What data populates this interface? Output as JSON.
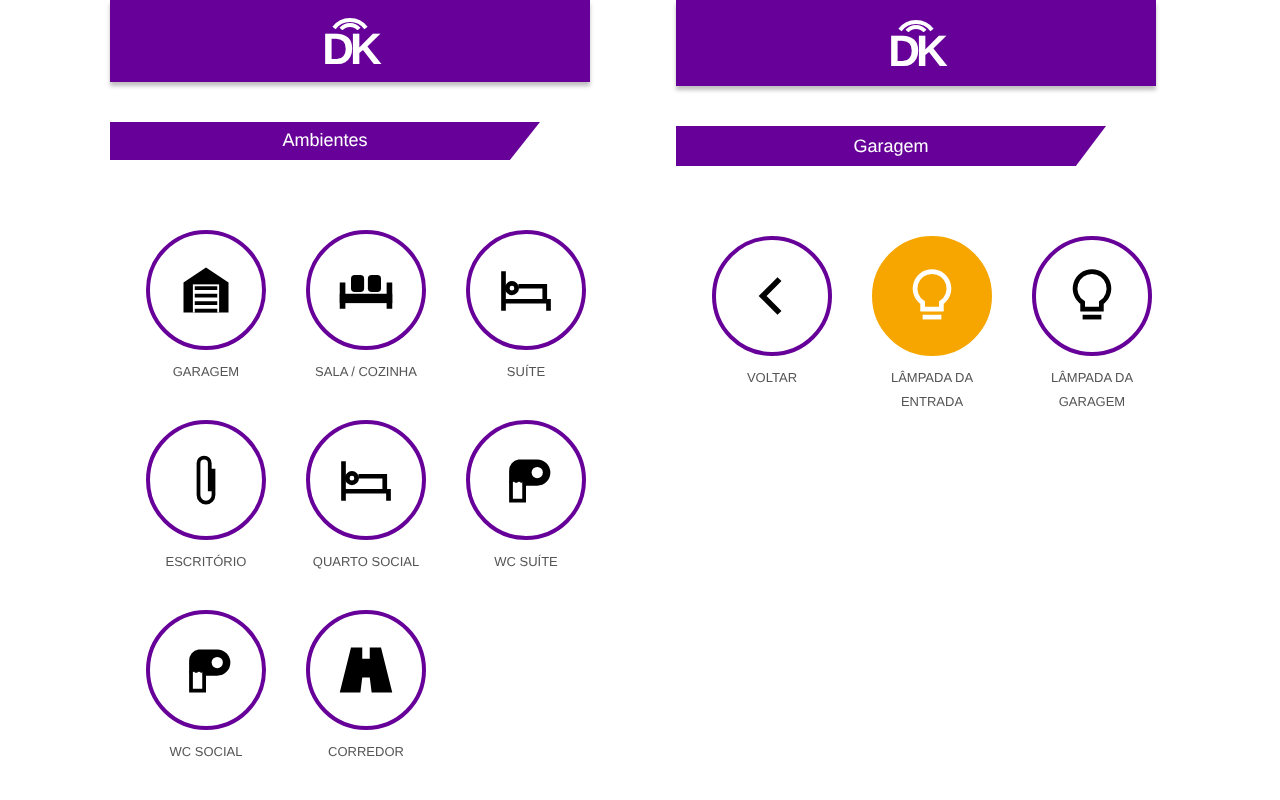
{
  "screens": [
    {
      "logo": "DK",
      "title": "Ambientes",
      "items": [
        {
          "kind": "garage",
          "label": "GARAGEM",
          "on": false
        },
        {
          "kind": "sofa",
          "label": "SALA / COZINHA",
          "on": false
        },
        {
          "kind": "bed",
          "label": "SUÍTE",
          "on": false
        },
        {
          "kind": "clip",
          "label": "ESCRITÓRIO",
          "on": false
        },
        {
          "kind": "bed",
          "label": "QUARTO SOCIAL",
          "on": false
        },
        {
          "kind": "paper",
          "label": "WC SUÍTE",
          "on": false
        },
        {
          "kind": "paper",
          "label": "WC SOCIAL",
          "on": false
        },
        {
          "kind": "road",
          "label": "CORREDOR",
          "on": false
        }
      ]
    },
    {
      "logo": "DK",
      "title": "Garagem",
      "items": [
        {
          "kind": "back",
          "label": "VOLTAR",
          "on": false
        },
        {
          "kind": "lamp",
          "label": "LÂMPADA DA ENTRADA",
          "on": true
        },
        {
          "kind": "lamp",
          "label": "LÂMPADA DA GARAGEM",
          "on": false
        }
      ]
    }
  ]
}
